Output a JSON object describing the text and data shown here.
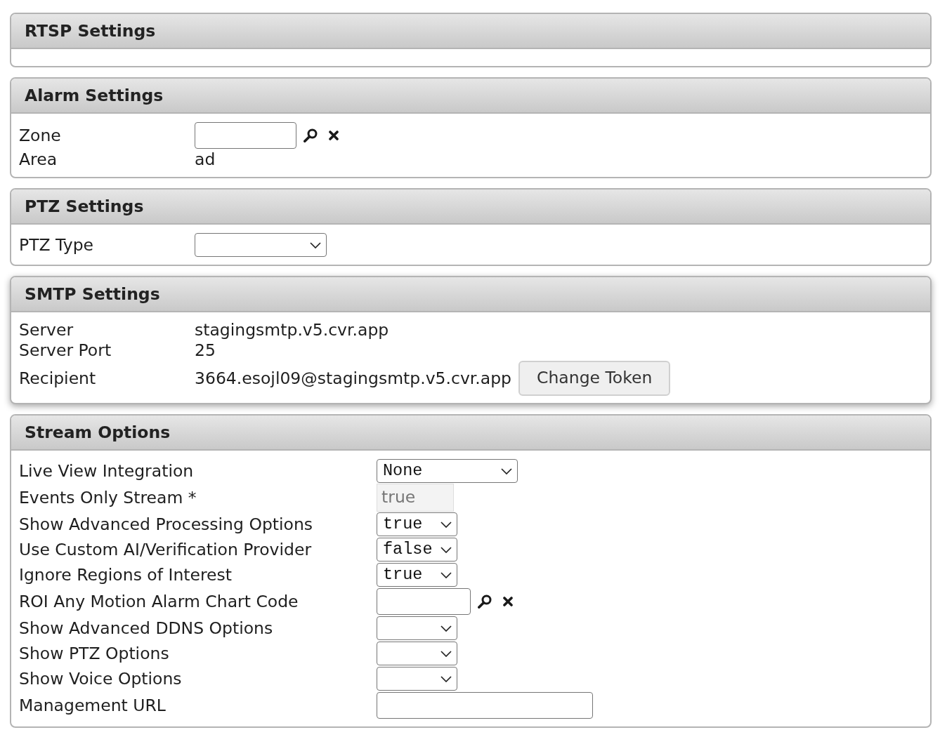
{
  "panels": [
    {
      "title": "RTSP Settings",
      "raised": false
    },
    {
      "title": "Alarm Settings",
      "raised": false,
      "rows": [
        {
          "kind": "lookup",
          "label": "Zone"
        },
        {
          "kind": "text",
          "label": "Area",
          "value": "ad"
        }
      ]
    },
    {
      "title": "PTZ Settings",
      "raised": false,
      "rows": [
        {
          "kind": "select",
          "label": "PTZ Type"
        }
      ]
    },
    {
      "title": "SMTP Settings",
      "raised": true,
      "rows": [
        {
          "kind": "text",
          "label": "Server",
          "value": "stagingsmtp.v5.cvr.app"
        },
        {
          "kind": "text",
          "label": "Server Port",
          "value": "25"
        },
        {
          "kind": "text_button",
          "label": "Recipient",
          "value": "3664.esojl09@stagingsmtp.v5.cvr.app",
          "button": "Change Token"
        }
      ]
    },
    {
      "title": "Stream Options",
      "raised": false,
      "rows": [
        {
          "kind": "select",
          "label": "Live View Integration",
          "value": "None"
        },
        {
          "kind": "readonly",
          "label": "Events Only Stream *",
          "value": "true"
        },
        {
          "kind": "select",
          "label": "Show Advanced Processing Options",
          "value": "true"
        },
        {
          "kind": "select",
          "label": "Use Custom AI/Verification Provider",
          "value": "false"
        },
        {
          "kind": "select",
          "label": "Ignore Regions of Interest",
          "value": "true"
        },
        {
          "kind": "lookup",
          "label": "ROI Any Motion Alarm Chart Code"
        },
        {
          "kind": "select",
          "label": "Show Advanced DDNS Options"
        },
        {
          "kind": "select",
          "label": "Show PTZ Options"
        },
        {
          "kind": "select",
          "label": "Show Voice Options"
        },
        {
          "kind": "input",
          "label": "Management URL"
        }
      ]
    }
  ]
}
